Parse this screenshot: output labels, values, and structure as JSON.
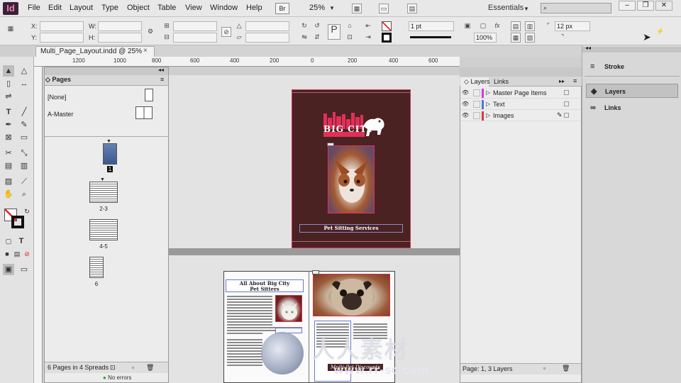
{
  "menubar": {
    "app_icon": "Id",
    "items": [
      "File",
      "Edit",
      "Layout",
      "Type",
      "Object",
      "Table",
      "View",
      "Window",
      "Help"
    ],
    "bridge_label": "Br",
    "zoom": "25%",
    "workspace": "Essentials"
  },
  "control": {
    "x_label": "X:",
    "y_label": "Y:",
    "w_label": "W:",
    "h_label": "H:",
    "stroke_weight": "1 pt",
    "opacity": "100%",
    "corner_size": "12 px"
  },
  "document_tab": {
    "title": "Multi_Page_Layout.indd @ 25%",
    "close": "×"
  },
  "ruler": {
    "ticks": [
      "1200",
      "1000",
      "800",
      "600",
      "400",
      "200",
      "0",
      "200",
      "400",
      "600",
      "800",
      "1000",
      "1200"
    ]
  },
  "pages_panel": {
    "title": "Pages",
    "masters": [
      "[None]",
      "A-Master"
    ],
    "page_labels": [
      "1",
      "2-3",
      "4-5",
      "6"
    ],
    "footer": "6 Pages in 4 Spreads"
  },
  "document": {
    "cover_caption": "Pet Sitting Services",
    "logo_text": "BIG CITY",
    "article_title_line1": "All About Big City",
    "article_title_line2": "Pet Sitters"
  },
  "layers_panel": {
    "tabs": [
      "Layers",
      "Links"
    ],
    "layers": [
      {
        "name": "Master Page Items",
        "color": "#d63ad6"
      },
      {
        "name": "Text",
        "color": "#4a7ad6"
      },
      {
        "name": "Images",
        "color": "#d63a3a"
      }
    ],
    "footer": "Page: 1, 3 Layers"
  },
  "dock": {
    "items": [
      "Stroke",
      "Layers",
      "Links"
    ]
  },
  "status": {
    "errors": "No errors"
  },
  "watermark": {
    "text": "人人素材",
    "url": "www.rr-sc.com",
    "strip_text": "Multi-Pet Discounts"
  }
}
